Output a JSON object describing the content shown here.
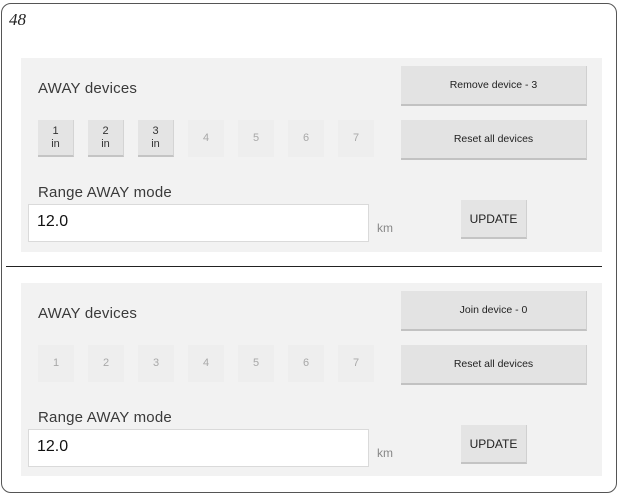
{
  "page": {
    "number": "48"
  },
  "panels": [
    {
      "away_label": "AWAY devices",
      "slots": [
        {
          "num": "1",
          "sub": "in",
          "active": true
        },
        {
          "num": "2",
          "sub": "in",
          "active": true
        },
        {
          "num": "3",
          "sub": "in",
          "active": true
        },
        {
          "num": "4",
          "sub": "",
          "active": false
        },
        {
          "num": "5",
          "sub": "",
          "active": false
        },
        {
          "num": "6",
          "sub": "",
          "active": false
        },
        {
          "num": "7",
          "sub": "",
          "active": false
        }
      ],
      "action_label": "Remove device - 3",
      "reset_label": "Reset all devices",
      "range_label": "Range AWAY mode",
      "range_value": "12.0",
      "unit": "km",
      "update_label": "UPDATE"
    },
    {
      "away_label": "AWAY devices",
      "slots": [
        {
          "num": "1",
          "sub": "",
          "active": false
        },
        {
          "num": "2",
          "sub": "",
          "active": false
        },
        {
          "num": "3",
          "sub": "",
          "active": false
        },
        {
          "num": "4",
          "sub": "",
          "active": false
        },
        {
          "num": "5",
          "sub": "",
          "active": false
        },
        {
          "num": "6",
          "sub": "",
          "active": false
        },
        {
          "num": "7",
          "sub": "",
          "active": false
        }
      ],
      "action_label": "Join device - 0",
      "reset_label": "Reset all devices",
      "range_label": "Range AWAY mode",
      "range_value": "12.0",
      "unit": "km",
      "update_label": "UPDATE"
    }
  ]
}
